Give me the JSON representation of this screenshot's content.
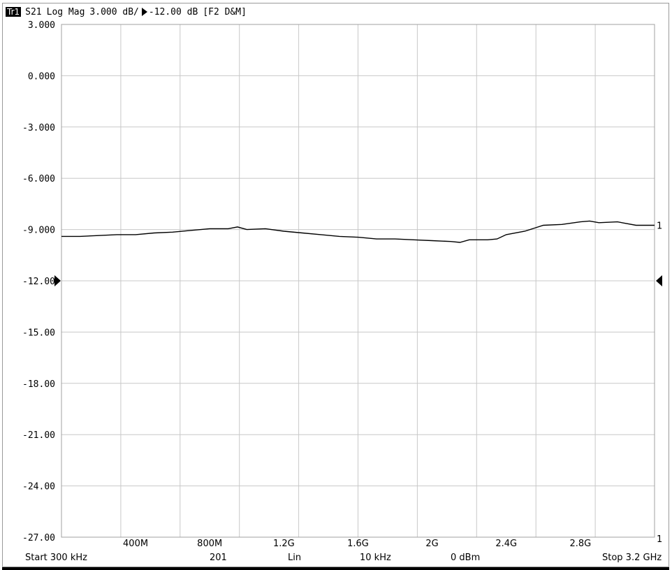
{
  "header": {
    "trace_badge": "Tr1",
    "parameter": "S21",
    "format": "Log Mag",
    "scale": "3.000 dB/",
    "reference": "-12.00 dB",
    "window": "[F2 D&M]"
  },
  "footer": {
    "start": "Start 300 kHz",
    "points": "201",
    "sweep_type": "Lin",
    "ifbw": "10 kHz",
    "power": "0 dBm",
    "stop": "Stop 3.2 GHz"
  },
  "markers": {
    "trace_end_label": "1",
    "axis_end_label": "1"
  },
  "colors": {
    "trace": "#000000",
    "grid": "#c8c8c8",
    "frame": "#9a9a9a"
  },
  "chart_data": {
    "type": "line",
    "title": "",
    "xlabel": "",
    "ylabel": "",
    "x_unit": "Hz",
    "xlim": [
      300000,
      3200000000
    ],
    "ylim": [
      -27,
      3
    ],
    "grid": true,
    "y_ticks": [
      {
        "value": 3,
        "label": "3.000"
      },
      {
        "value": 0,
        "label": "0.000"
      },
      {
        "value": -3,
        "label": "-3.000"
      },
      {
        "value": -6,
        "label": "-6.000"
      },
      {
        "value": -9,
        "label": "-9.000"
      },
      {
        "value": -12,
        "label": "-12.00"
      },
      {
        "value": -15,
        "label": "-15.00"
      },
      {
        "value": -18,
        "label": "-18.00"
      },
      {
        "value": -21,
        "label": "-21.00"
      },
      {
        "value": -24,
        "label": "-24.00"
      },
      {
        "value": -27,
        "label": "-27.00"
      }
    ],
    "x_ticks": [
      {
        "value": 400000000,
        "label": "400M"
      },
      {
        "value": 800000000,
        "label": "800M"
      },
      {
        "value": 1200000000,
        "label": "1.2G"
      },
      {
        "value": 1600000000,
        "label": "1.6G"
      },
      {
        "value": 2000000000,
        "label": "2G"
      },
      {
        "value": 2400000000,
        "label": "2.4G"
      },
      {
        "value": 2800000000,
        "label": "2.8G"
      }
    ],
    "reference_level": -12,
    "series": [
      {
        "x": [
          300000,
          100000000,
          200000000,
          300000000,
          400000000,
          500000000,
          600000000,
          700000000,
          800000000,
          900000000,
          950000000,
          1000000000,
          1100000000,
          1200000000,
          1300000000,
          1400000000,
          1500000000,
          1600000000,
          1700000000,
          1800000000,
          1900000000,
          2000000000,
          2100000000,
          2150000000,
          2200000000,
          2300000000,
          2350000000,
          2400000000,
          2500000000,
          2600000000,
          2700000000,
          2800000000,
          2850000000,
          2900000000,
          3000000000,
          3100000000,
          3200000000
        ],
        "y": [
          -9.4,
          -9.4,
          -9.35,
          -9.3,
          -9.3,
          -9.2,
          -9.15,
          -9.05,
          -8.95,
          -8.95,
          -8.85,
          -9.0,
          -8.95,
          -9.1,
          -9.2,
          -9.3,
          -9.4,
          -9.45,
          -9.55,
          -9.55,
          -9.6,
          -9.65,
          -9.7,
          -9.75,
          -9.6,
          -9.6,
          -9.55,
          -9.3,
          -9.1,
          -8.75,
          -8.7,
          -8.55,
          -8.5,
          -8.6,
          -8.55,
          -8.75,
          -8.75
        ]
      }
    ]
  }
}
